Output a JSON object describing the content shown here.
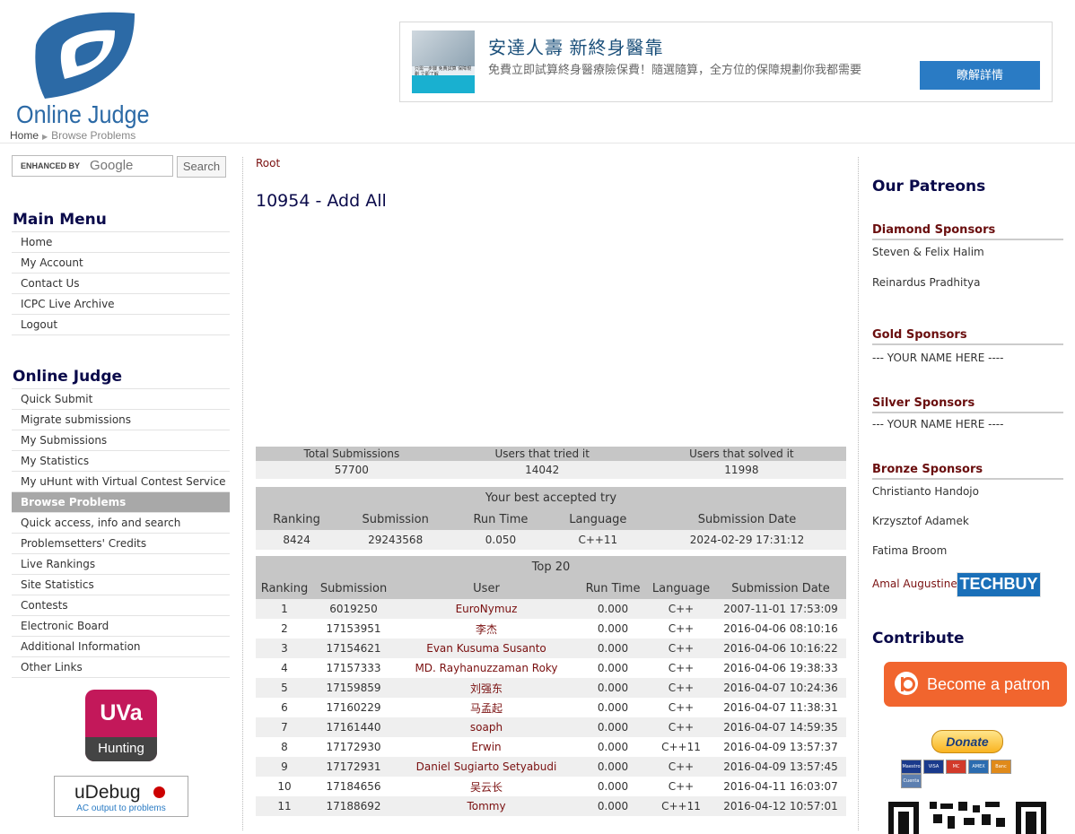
{
  "header": {
    "logo_text": "Online Judge",
    "breadcrumb": [
      "Home",
      "Browse Problems"
    ]
  },
  "ad": {
    "title": "安達人壽 新終身醫靠",
    "description": "免費立即試算終身醫療險保費！隨選隨算，全方位的保障規劃你我都需要",
    "button": "瞭解詳情",
    "thumb_text": "只需一步驟\n免費試算 保障規劃\n立即了解"
  },
  "search": {
    "label": "ENHANCED BY",
    "brand": "Google",
    "button": "Search"
  },
  "main_menu": {
    "title": "Main Menu",
    "items": [
      "Home",
      "My Account",
      "Contact Us",
      "ICPC Live Archive",
      "Logout"
    ]
  },
  "oj_menu": {
    "title": "Online Judge",
    "items": [
      "Quick Submit",
      "Migrate submissions",
      "My Submissions",
      "My Statistics",
      "My uHunt with Virtual Contest Service",
      "Browse Problems",
      "Quick access, info and search",
      "Problemsetters' Credits",
      "Live Rankings",
      "Site Statistics",
      "Contests",
      "Electronic Board",
      "Additional Information",
      "Other Links"
    ],
    "active": "Browse Problems"
  },
  "uva": {
    "title": "UVa",
    "subtitle": "Hunting"
  },
  "udebug": {
    "title": "uDebug",
    "subtitle": "AC output to problems"
  },
  "problem": {
    "root": "Root",
    "title": "10954 - Add All"
  },
  "stats": {
    "headers": [
      "Total Submissions",
      "Users that tried it",
      "Users that solved it"
    ],
    "values": [
      "57700",
      "14042",
      "11998"
    ]
  },
  "best": {
    "caption": "Your best accepted try",
    "headers": [
      "Ranking",
      "Submission",
      "Run Time",
      "Language",
      "Submission Date"
    ],
    "values": [
      "8424",
      "29243568",
      "0.050",
      "C++11",
      "2024-02-29 17:31:12"
    ]
  },
  "top20": {
    "caption": "Top 20",
    "headers": [
      "Ranking",
      "Submission",
      "User",
      "Run Time",
      "Language",
      "Submission Date"
    ],
    "rows": [
      [
        "1",
        "6019250",
        "EuroNymuz",
        "0.000",
        "C++",
        "2007-11-01 17:53:09"
      ],
      [
        "2",
        "17153951",
        "李杰",
        "0.000",
        "C++",
        "2016-04-06 08:10:16"
      ],
      [
        "3",
        "17154621",
        "Evan Kusuma Susanto",
        "0.000",
        "C++",
        "2016-04-06 10:16:22"
      ],
      [
        "4",
        "17157333",
        "MD. Rayhanuzzaman Roky",
        "0.000",
        "C++",
        "2016-04-06 19:38:33"
      ],
      [
        "5",
        "17159859",
        "刘强东",
        "0.000",
        "C++",
        "2016-04-07 10:24:36"
      ],
      [
        "6",
        "17160229",
        "马孟起",
        "0.000",
        "C++",
        "2016-04-07 11:38:31"
      ],
      [
        "7",
        "17161440",
        "soaph",
        "0.000",
        "C++",
        "2016-04-07 14:59:35"
      ],
      [
        "8",
        "17172930",
        "Erwin",
        "0.000",
        "C++11",
        "2016-04-09 13:57:37"
      ],
      [
        "9",
        "17172931",
        "Daniel Sugiarto Setyabudi",
        "0.000",
        "C++",
        "2016-04-09 13:57:45"
      ],
      [
        "10",
        "17184656",
        "吴云长",
        "0.000",
        "C++",
        "2016-04-11 16:03:07"
      ],
      [
        "11",
        "17188692",
        "Tommy",
        "0.000",
        "C++11",
        "2016-04-12 10:57:01"
      ]
    ]
  },
  "right": {
    "patreons_title": "Our Patreons",
    "diamond_title": "Diamond Sponsors",
    "diamond": [
      "Steven & Felix Halim",
      "Reinardus Pradhitya"
    ],
    "gold_title": "Gold Sponsors",
    "gold": [
      "--- YOUR NAME HERE ----"
    ],
    "silver_title": "Silver Sponsors",
    "silver": [
      "--- YOUR NAME HERE ----"
    ],
    "bronze_title": "Bronze Sponsors",
    "bronze": [
      "Christianto Handojo",
      "Krzysztof Adamek",
      "Fatima Broom",
      "Amal Augustine"
    ],
    "techbuy": "TECHBUY",
    "contribute_title": "Contribute",
    "patron_button": "Become a patron",
    "donate_button": "Donate",
    "cards": [
      "Maestro",
      "VISA",
      "MC",
      "AMEX",
      "Banc",
      "Cuenta bancaria"
    ]
  }
}
